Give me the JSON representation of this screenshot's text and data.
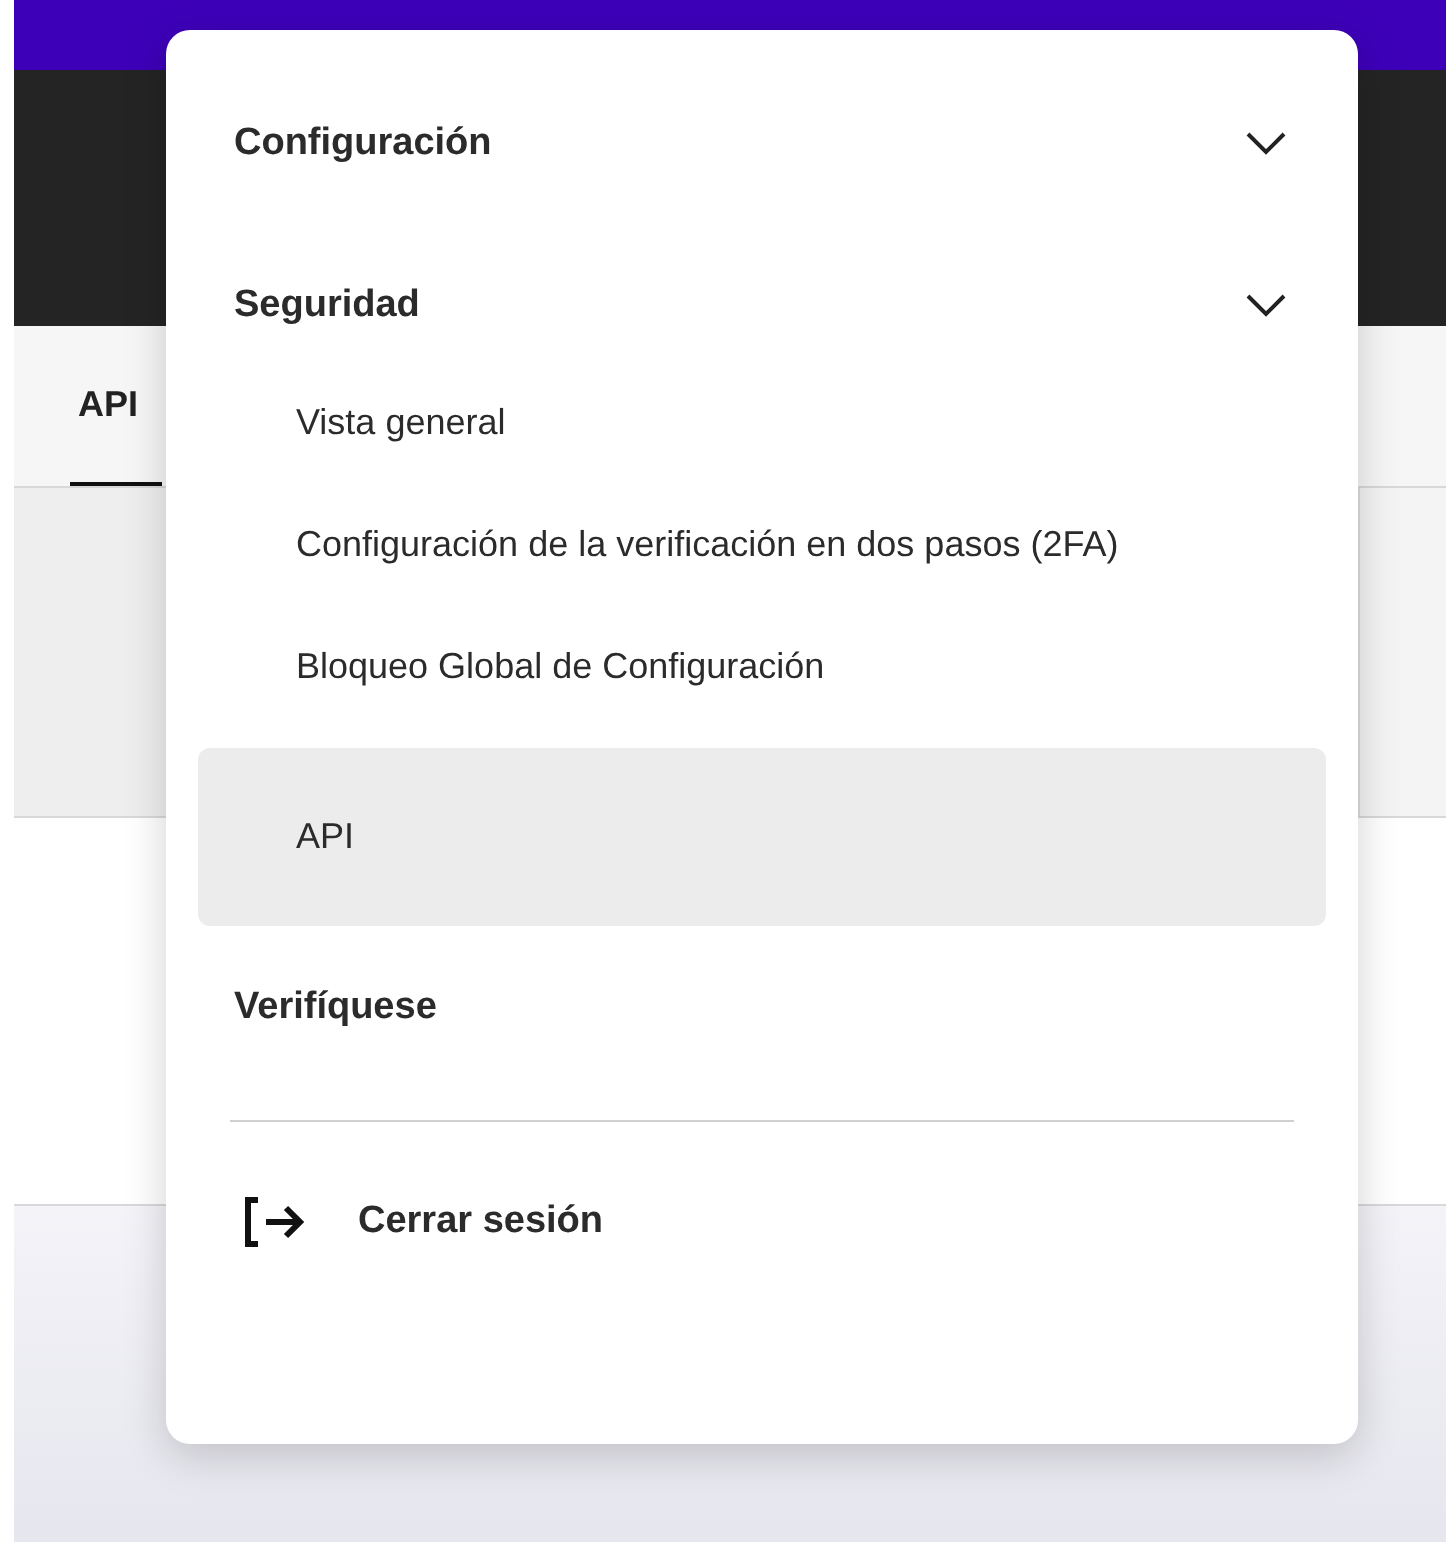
{
  "tabs": [
    {
      "label": "API",
      "selected": true
    }
  ],
  "menu": {
    "items": [
      {
        "kind": "group",
        "label": "Configuración"
      },
      {
        "kind": "group",
        "label": "Seguridad",
        "children": [
          {
            "label": "Vista general",
            "selected": false
          },
          {
            "label": "Configuración de la verificación en dos pasos (2FA)",
            "selected": false
          },
          {
            "label": "Bloqueo Global de Configuración",
            "selected": false
          },
          {
            "label": "API",
            "selected": true
          }
        ]
      },
      {
        "kind": "link",
        "label": "Verifíquese"
      },
      {
        "kind": "divider"
      },
      {
        "kind": "logout",
        "label": "Cerrar sesión"
      }
    ]
  }
}
